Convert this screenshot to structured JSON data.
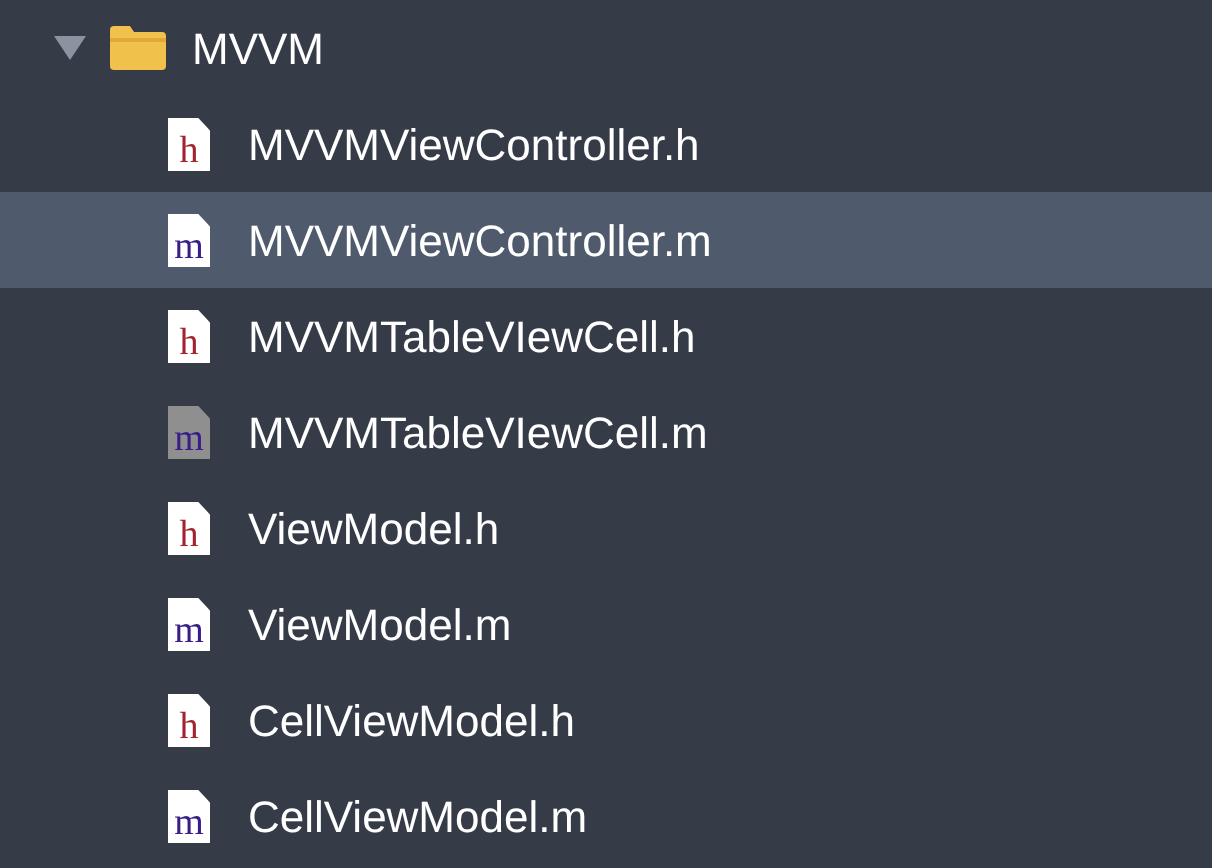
{
  "folder": {
    "name": "MVVM",
    "expanded": true,
    "children": [
      {
        "name": "MVVMViewController.h",
        "badge": "h",
        "kind": "header",
        "selected": false,
        "greyed": false
      },
      {
        "name": "MVVMViewController.m",
        "badge": "m",
        "kind": "implementation",
        "selected": true,
        "greyed": false
      },
      {
        "name": "MVVMTableVIewCell.h",
        "badge": "h",
        "kind": "header",
        "selected": false,
        "greyed": false
      },
      {
        "name": "MVVMTableVIewCell.m",
        "badge": "m",
        "kind": "implementation",
        "selected": false,
        "greyed": true
      },
      {
        "name": "ViewModel.h",
        "badge": "h",
        "kind": "header",
        "selected": false,
        "greyed": false
      },
      {
        "name": "ViewModel.m",
        "badge": "m",
        "kind": "implementation",
        "selected": false,
        "greyed": false
      },
      {
        "name": "CellViewModel.h",
        "badge": "h",
        "kind": "header",
        "selected": false,
        "greyed": false
      },
      {
        "name": "CellViewModel.m",
        "badge": "m",
        "kind": "implementation",
        "selected": false,
        "greyed": false
      }
    ]
  }
}
